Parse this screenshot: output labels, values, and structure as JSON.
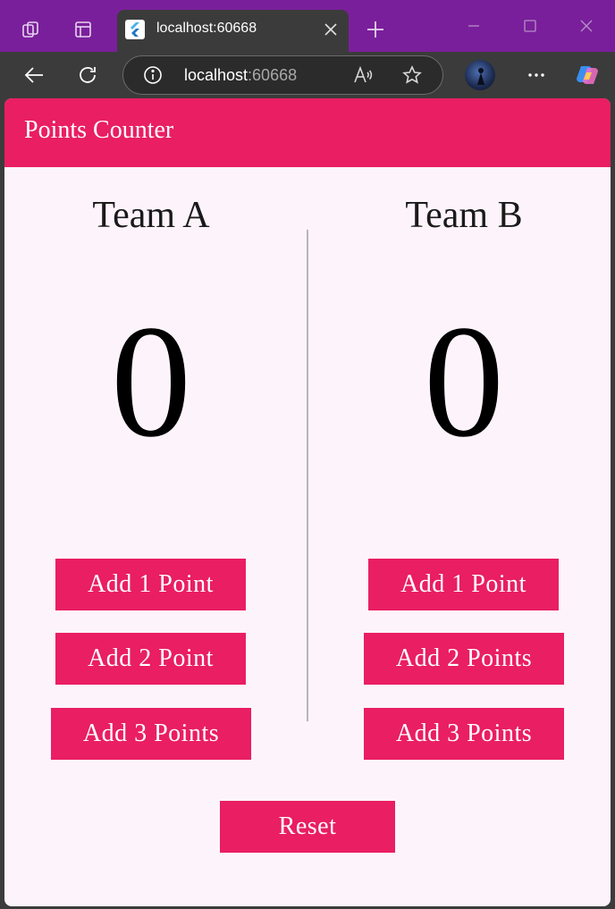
{
  "browser": {
    "tab_title": "localhost:60668",
    "url_host": "localhost",
    "url_port": ":60668"
  },
  "app": {
    "title": "Points Counter"
  },
  "team_a": {
    "name": "Team A",
    "score": "0",
    "buttons": [
      "Add 1 Point",
      "Add 2 Point",
      "Add 3 Points"
    ]
  },
  "team_b": {
    "name": "Team B",
    "score": "0",
    "buttons": [
      "Add 1 Point",
      "Add 2 Points",
      "Add 3 Points"
    ]
  },
  "reset_label": "Reset",
  "colors": {
    "accent": "#e91e63",
    "tab_strip": "#7a1f9b",
    "page_bg": "#fdf4fb"
  }
}
